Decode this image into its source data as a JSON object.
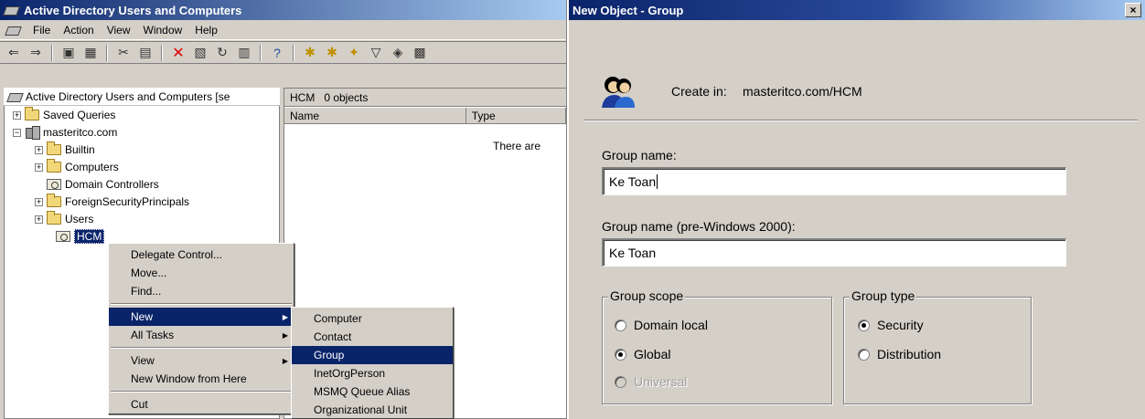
{
  "aduc": {
    "title": "Active Directory Users and Computers",
    "menu": [
      "File",
      "Action",
      "View",
      "Window",
      "Help"
    ],
    "tree_header": "Active Directory Users and Computers [se",
    "tree": {
      "saved_queries": "Saved Queries",
      "domain": "masteritco.com",
      "builtin": "Builtin",
      "computers": "Computers",
      "domain_controllers": "Domain Controllers",
      "fsp": "ForeignSecurityPrincipals",
      "users": "Users",
      "hcm": "HCM"
    },
    "right_pane": {
      "container": "HCM",
      "count": "0 objects",
      "columns": [
        "Name",
        "Type"
      ],
      "empty_text": "There are"
    }
  },
  "context_menu": {
    "items": [
      "Delegate Control...",
      "Move...",
      "Find...",
      "New",
      "All Tasks",
      "View",
      "New Window from Here",
      "Cut"
    ]
  },
  "new_submenu": {
    "items": [
      "Computer",
      "Contact",
      "Group",
      "InetOrgPerson",
      "MSMQ Queue Alias",
      "Organizational Unit"
    ]
  },
  "dialog": {
    "title": "New Object - Group",
    "close_glyph": "×",
    "create_in_label": "Create in:",
    "create_in_value": "masteritco.com/HCM",
    "group_name_label": "Group name:",
    "group_name_value": "Ke Toan",
    "pre2000_label": "Group name (pre-Windows 2000):",
    "pre2000_value": "Ke Toan",
    "scope": {
      "legend": "Group scope",
      "options": [
        "Domain local",
        "Global",
        "Universal"
      ],
      "selected": "Global"
    },
    "type": {
      "legend": "Group type",
      "options": [
        "Security",
        "Distribution"
      ],
      "selected": "Security"
    }
  }
}
